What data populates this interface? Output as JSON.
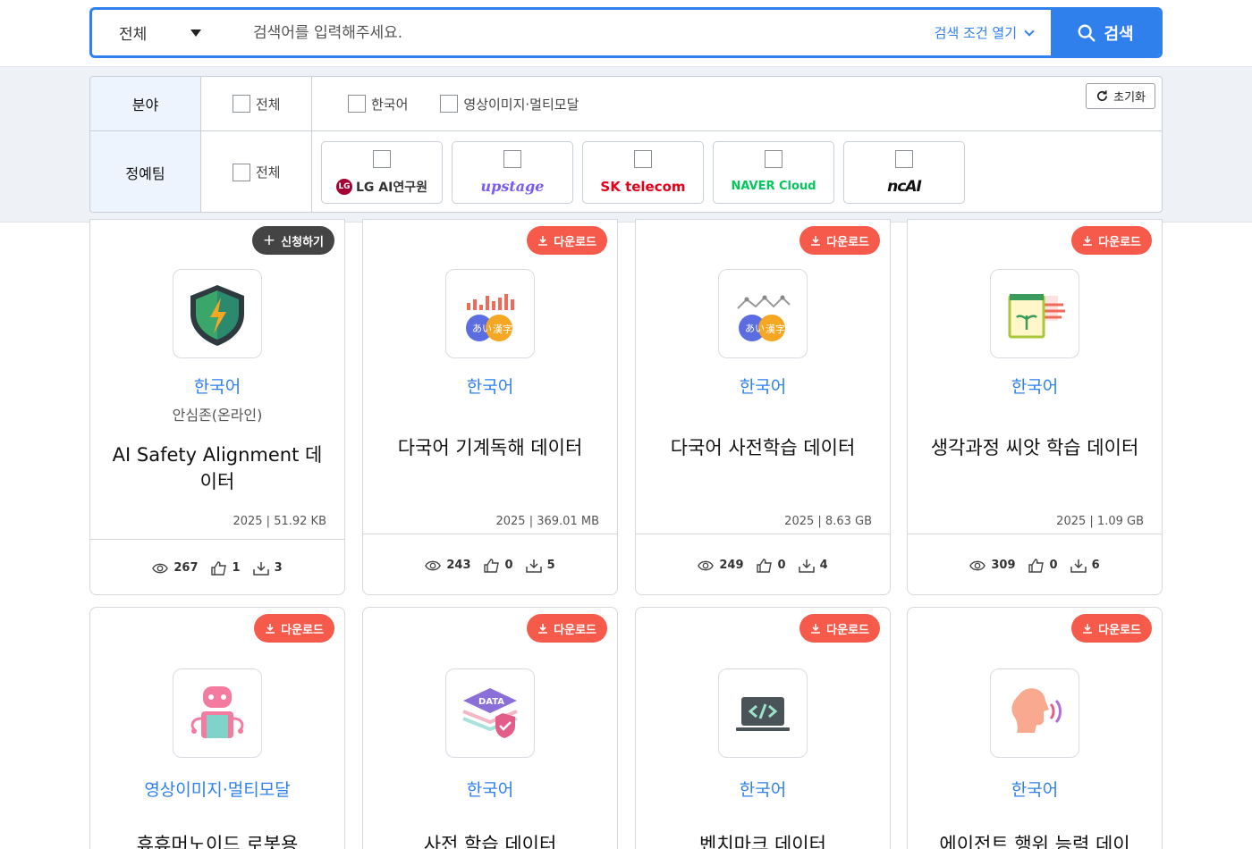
{
  "search": {
    "scope": "전체",
    "placeholder": "검색어를 입력해주세요.",
    "conditions_label": "검색 조건 열기",
    "button_label": "검색"
  },
  "filter": {
    "field_header": "분야",
    "field_all": "전체",
    "field_options": [
      "한국어",
      "영상이미지·멀티모달"
    ],
    "team_header": "정예팀",
    "team_all": "전체",
    "reset_label": "초기화",
    "teams": [
      "LG AI연구원",
      "upstage",
      "SK telecom",
      "NAVER Cloud",
      "ncAI"
    ]
  },
  "cards": [
    {
      "badge": "신청하기",
      "category": "한국어",
      "org": "안심존(온라인)",
      "title": "AI Safety Alignment 데이터",
      "year": "2025",
      "size": "51.92 KB",
      "views": "267",
      "likes": "1",
      "downloads": "3"
    },
    {
      "badge": "다운로드",
      "category": "한국어",
      "org": "",
      "title": "다국어 기계독해 데이터",
      "year": "2025",
      "size": "369.01 MB",
      "views": "243",
      "likes": "0",
      "downloads": "5"
    },
    {
      "badge": "다운로드",
      "category": "한국어",
      "org": "",
      "title": "다국어 사전학습 데이터",
      "year": "2025",
      "size": "8.63 GB",
      "views": "249",
      "likes": "0",
      "downloads": "4"
    },
    {
      "badge": "다운로드",
      "category": "한국어",
      "org": "",
      "title": "생각과정 씨앗 학습 데이터",
      "year": "2025",
      "size": "1.09 GB",
      "views": "309",
      "likes": "0",
      "downloads": "6"
    },
    {
      "badge": "다운로드",
      "category": "영상이미지·멀티모달",
      "title": "휴휴머노이드 로봇용"
    },
    {
      "badge": "다운로드",
      "category": "한국어",
      "title": "사전 학습 데이터"
    },
    {
      "badge": "다운로드",
      "category": "한국어",
      "title": "벤치마크 데이터"
    },
    {
      "badge": "다운로드",
      "category": "한국어",
      "title": "에이전트 행위 능력 데이"
    }
  ],
  "colors": {
    "accent": "#2f80ed",
    "download_badge": "#f65a4b",
    "apply_badge": "#444444",
    "header_bg": "#edf4fd"
  }
}
